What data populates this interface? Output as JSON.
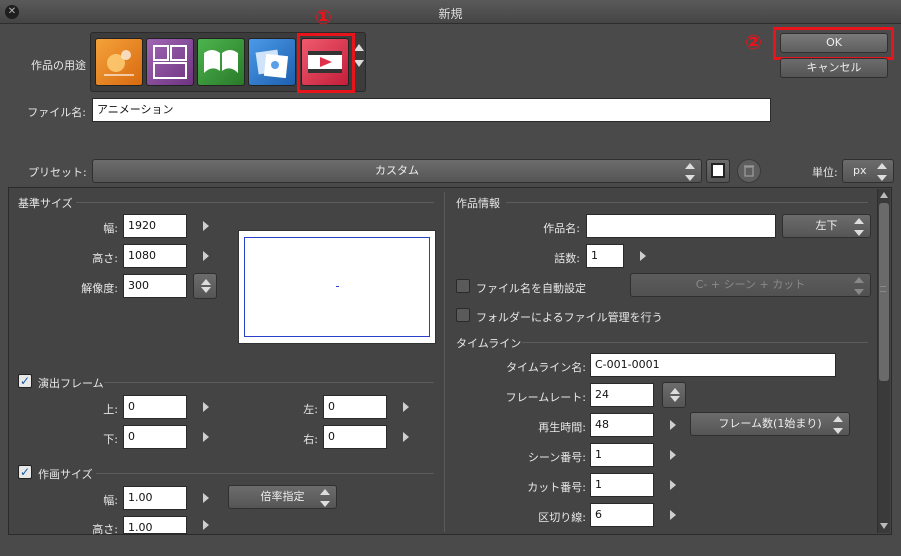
{
  "window": {
    "title": "新規",
    "close_icon": "close-icon"
  },
  "annotations": {
    "marker1": "①",
    "marker2": "②",
    "highlight_color": "#e8141c"
  },
  "header": {
    "usage_label": "作品の用途",
    "usage_icons": [
      {
        "name": "illustration-icon",
        "color": "#e8821e"
      },
      {
        "name": "comic-icon",
        "color": "#8a4a9c"
      },
      {
        "name": "book-icon",
        "color": "#3a9a3a"
      },
      {
        "name": "print-icon",
        "color": "#2f7fd0"
      },
      {
        "name": "animation-icon",
        "color": "#e0304a"
      }
    ],
    "filename_label": "ファイル名:",
    "filename_value": "アニメーション",
    "ok_label": "OK",
    "cancel_label": "キャンセル"
  },
  "preset": {
    "label": "プリセット:",
    "value": "カスタム",
    "unit_label": "単位:",
    "unit_value": "px"
  },
  "left": {
    "base_size_title": "基準サイズ",
    "width_label": "幅:",
    "width_value": "1920",
    "height_label": "高さ:",
    "height_value": "1080",
    "resolution_label": "解像度:",
    "resolution_value": "300",
    "direction_frame_label": "演出フレーム",
    "top_label": "上:",
    "top_value": "0",
    "left_label": "左:",
    "left_value": "0",
    "bottom_label": "下:",
    "bottom_value": "0",
    "right_label": "右:",
    "right_value": "0",
    "canvas_size_label": "作画サイズ",
    "canvas_width_label": "幅:",
    "canvas_width_value": "1.00",
    "scale_button": "倍率指定",
    "canvas_height_label": "高さ:",
    "canvas_height_value": "1.00"
  },
  "right": {
    "work_info_title": "作品情報",
    "work_name_label": "作品名:",
    "work_name_value": "",
    "position_value": "左下",
    "episode_label": "話数:",
    "episode_value": "1",
    "auto_filename_label": "ファイル名を自動設定",
    "auto_filename_combo": "C- + シーン + カット",
    "folder_manage_label": "フォルダーによるファイル管理を行う",
    "timeline_title": "タイムライン",
    "timeline_name_label": "タイムライン名:",
    "timeline_name_value": "C-001-0001",
    "framerate_label": "フレームレート:",
    "framerate_value": "24",
    "playtime_label": "再生時間:",
    "playtime_value": "48",
    "frame_count_combo": "フレーム数(1始まり)",
    "scene_label": "シーン番号:",
    "scene_value": "1",
    "cut_label": "カット番号:",
    "cut_value": "1",
    "divider_label": "区切り線:",
    "divider_value": "6"
  }
}
